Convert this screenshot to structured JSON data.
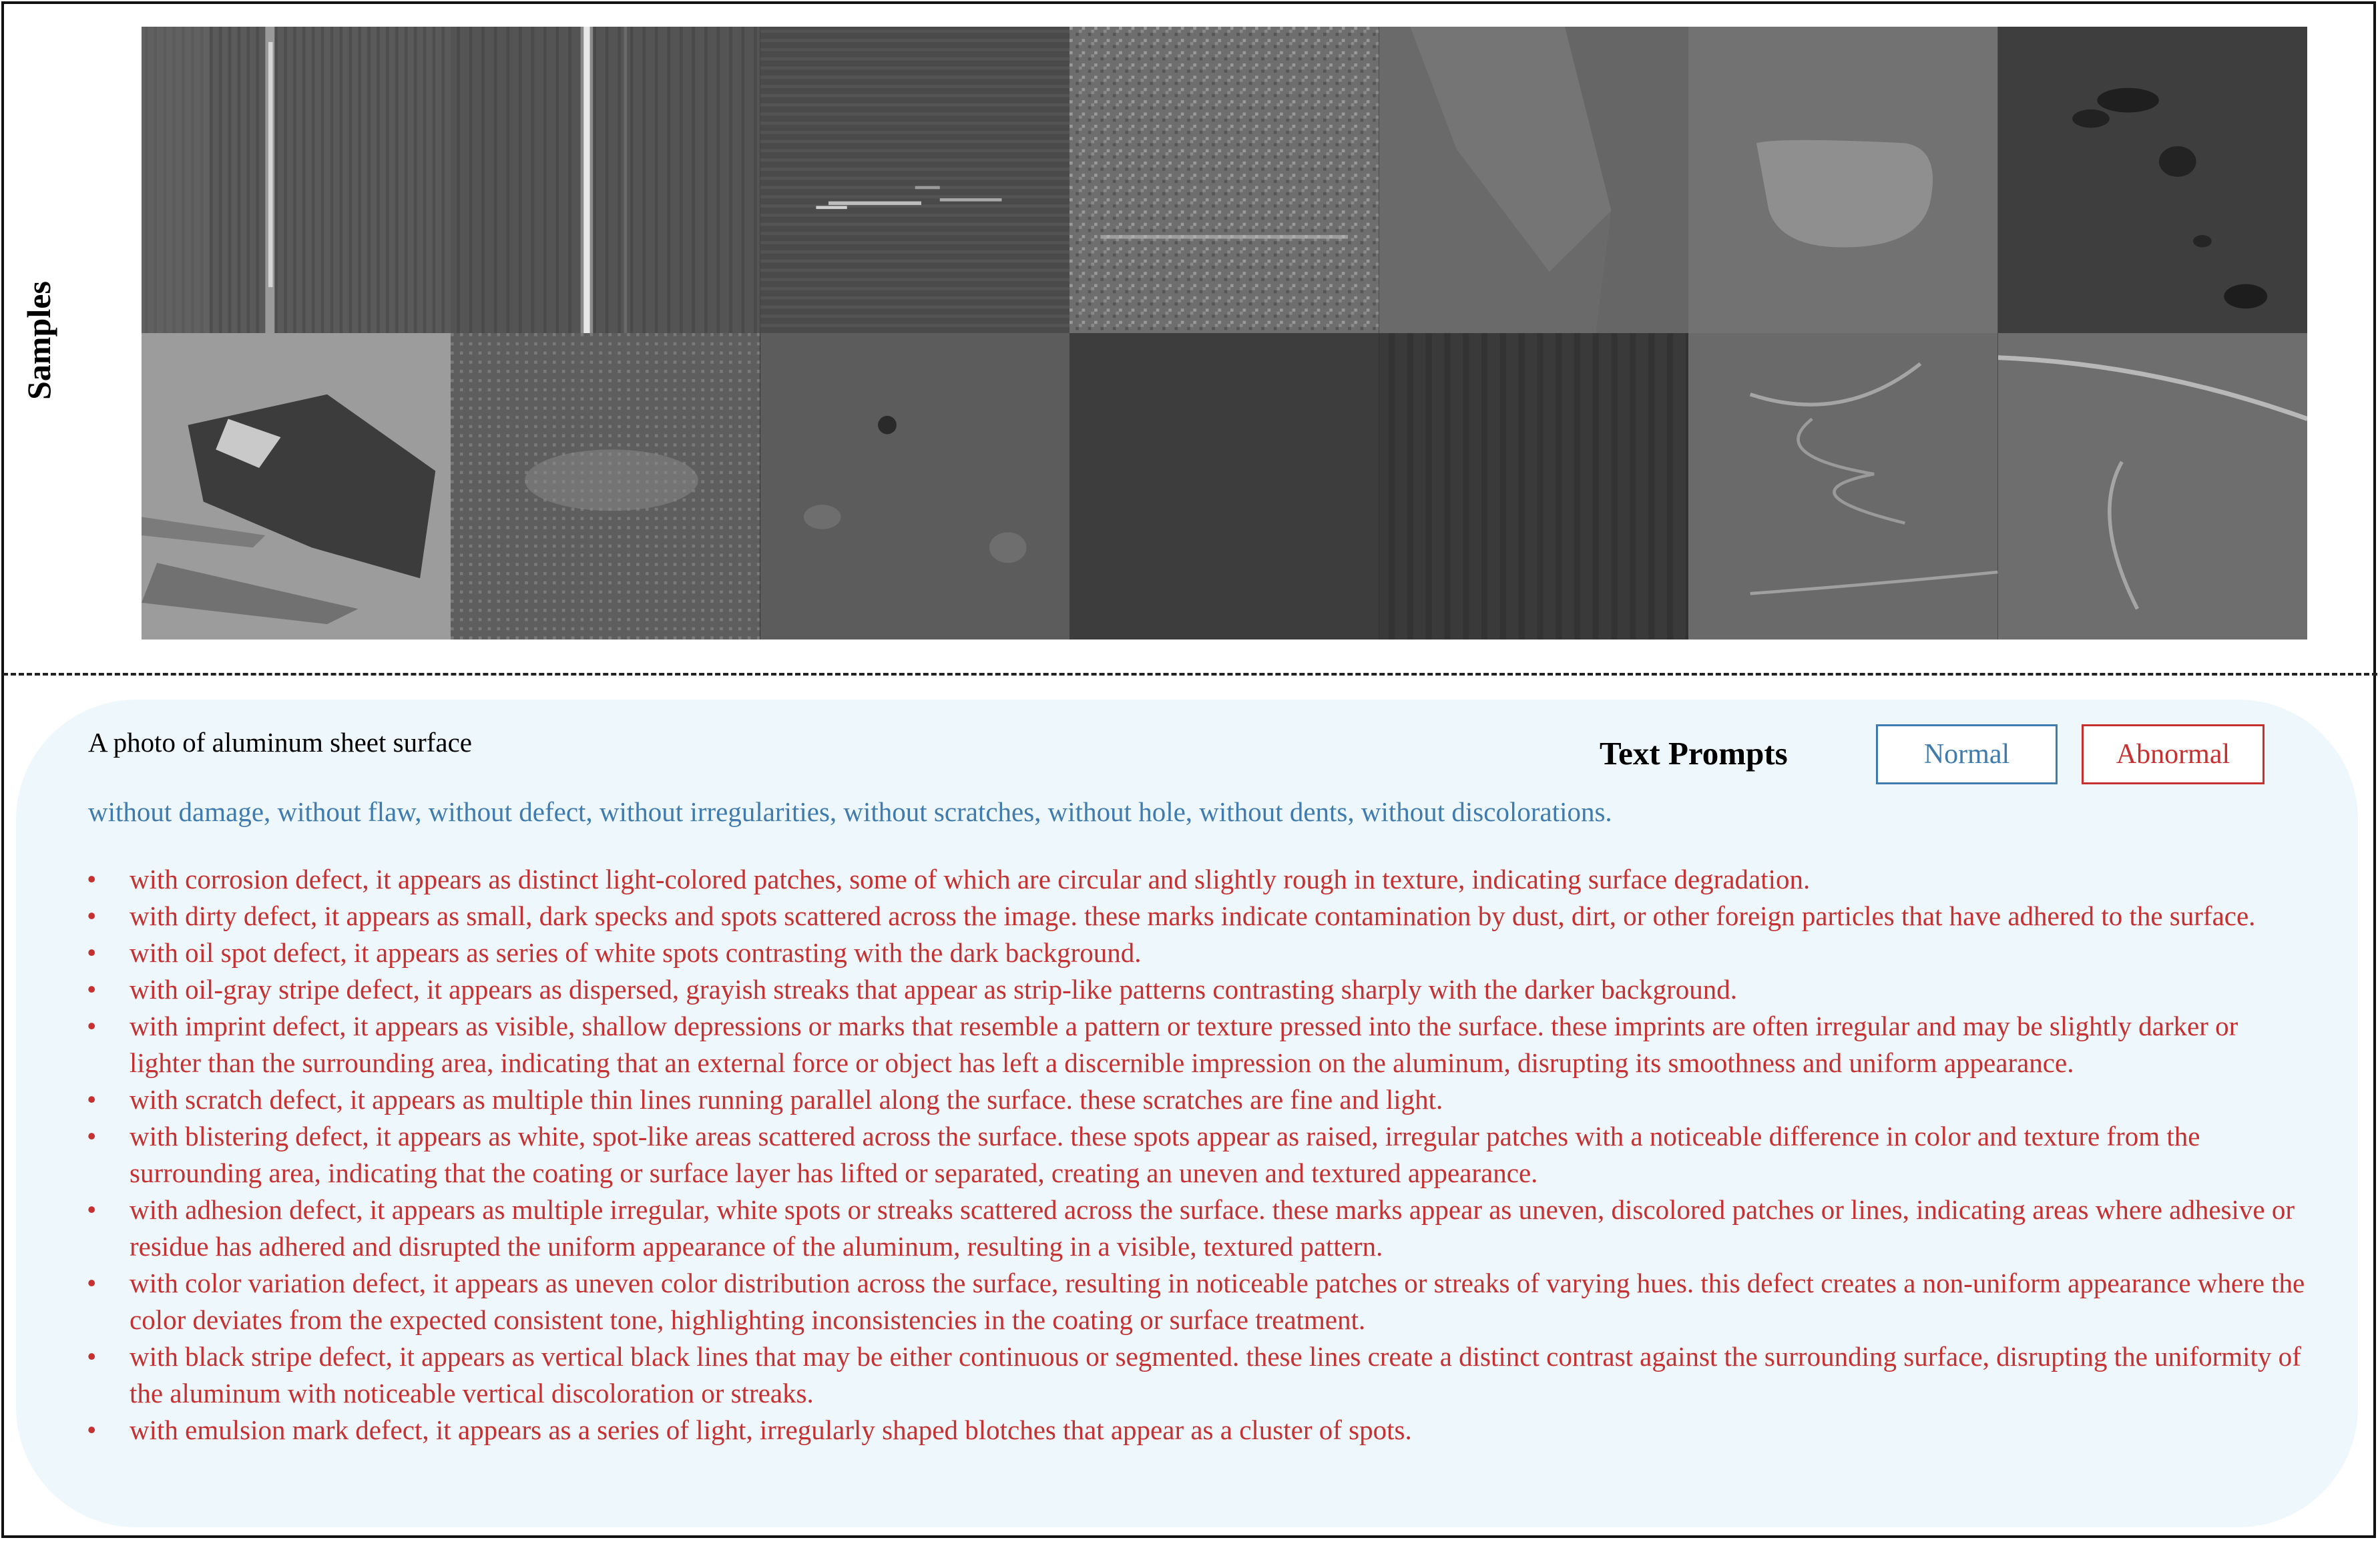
{
  "samples_label": "Samples",
  "lead_text": "A photo of aluminum sheet surface",
  "text_prompts_title": "Text Prompts",
  "legend": {
    "normal_label": "Normal",
    "abnormal_label": "Abnormal",
    "normal_color": "#3f7bae",
    "abnormal_color": "#c63030"
  },
  "normal_prompts": "without damage, without flaw, without defect, without irregularities, without scratches, without hole, without dents, without discolorations.",
  "abnormal_prompts": [
    "with corrosion defect, it appears as distinct light-colored patches, some of which are circular and slightly rough in texture, indicating surface degradation.",
    "with dirty defect, it appears as small, dark specks and spots scattered across the image. these marks indicate contamination by dust, dirt, or other foreign particles that have adhered to the surface.",
    "with oil spot defect, it appears as series of white spots contrasting with the dark background.",
    "with oil-gray stripe defect, it appears as dispersed, grayish streaks that appear as strip-like patterns contrasting sharply with the darker background.",
    "with imprint defect, it appears as visible, shallow depressions or marks that resemble a pattern or texture pressed into the surface. these imprints are often irregular and may be slightly darker or lighter than the surrounding area, indicating that an external force or object has left a discernible impression on the aluminum, disrupting its smoothness and uniform appearance.",
    "with scratch defect, it appears as multiple thin lines running parallel along the surface. these scratches are fine and light.",
    "with blistering defect, it appears as white, spot-like areas scattered across the surface. these spots appear as raised, irregular patches with a noticeable difference in color and texture from the surrounding area, indicating that the coating or surface layer has lifted or separated, creating an uneven and textured appearance.",
    "with adhesion defect, it appears as multiple irregular, white spots or streaks scattered across the surface. these marks appear as uneven, discolored patches or lines, indicating areas where adhesive or residue has adhered and disrupted the uniform appearance of the aluminum, resulting in a visible, textured pattern.",
    "with color variation defect, it appears as uneven color distribution across the surface, resulting in noticeable patches or streaks of varying hues. this defect creates a non-uniform appearance where the color deviates from the expected consistent tone, highlighting inconsistencies in the coating or surface treatment.",
    "with black stripe defect, it appears as vertical black lines that may be either continuous or segmented. these lines create a distinct contrast against the surrounding surface, disrupting the uniformity of the aluminum with noticeable vertical discoloration or streaks.",
    "with emulsion mark defect, it appears as a series of light, irregularly shaped blotches that appear as a cluster of spots."
  ]
}
